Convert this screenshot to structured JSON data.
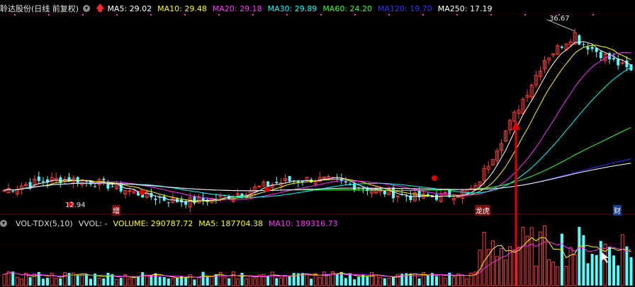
{
  "header": {
    "title": "聆达股份(日线 前复权)",
    "ma": [
      {
        "label": "MA5: 29.02",
        "color": "#ffffff"
      },
      {
        "label": "MA10: 29.48",
        "color": "#ffff00"
      },
      {
        "label": "MA20: 29.18",
        "color": "#ff33ff"
      },
      {
        "label": "MA30: 29.89",
        "color": "#00ffff"
      },
      {
        "label": "MA60: 24.20",
        "color": "#33ff33"
      },
      {
        "label": "MA120: 19.70",
        "color": "#3333ff"
      },
      {
        "label": "MA250: 17.19",
        "color": "#ffffff"
      }
    ]
  },
  "annotations": {
    "high": "36.67",
    "low": "12.94"
  },
  "events": {
    "zeng": "增",
    "longhu": "龙虎",
    "cai": "财"
  },
  "vol_header": {
    "indicator": "VOL-TDX(5,10)",
    "vvol": "VVOL: -",
    "volume": {
      "label": "VOLUME: 290787.72",
      "color": "#ffff00"
    },
    "ma5": {
      "label": "MA5: 187704.38",
      "color": "#ffff00"
    },
    "ma10": {
      "label": "MA10: 189316.73",
      "color": "#ff33ff"
    }
  },
  "colors": {
    "up": "#ff3c3c",
    "down": "#54ffff",
    "grid": "#7a0000"
  },
  "chart_data": [
    {
      "type": "candlestick",
      "title": "聆达股份(日线 前复权)",
      "summary_visible": {
        "high": 36.67,
        "low": 12.94
      },
      "series": [
        {
          "name": "MA5",
          "last": 29.02
        },
        {
          "name": "MA10",
          "last": 29.48
        },
        {
          "name": "MA20",
          "last": 29.18
        },
        {
          "name": "MA30",
          "last": 29.89
        },
        {
          "name": "MA60",
          "last": 24.2
        },
        {
          "name": "MA120",
          "last": 19.7
        },
        {
          "name": "MA250",
          "last": 17.19
        }
      ],
      "ylim": [
        11.5,
        38.5
      ]
    },
    {
      "type": "bar",
      "title": "VOL-TDX(5,10)",
      "series": [
        {
          "name": "VOLUME",
          "last": 290787.72
        },
        {
          "name": "MA5",
          "last": 187704.38
        },
        {
          "name": "MA10",
          "last": 189316.73
        }
      ]
    }
  ]
}
